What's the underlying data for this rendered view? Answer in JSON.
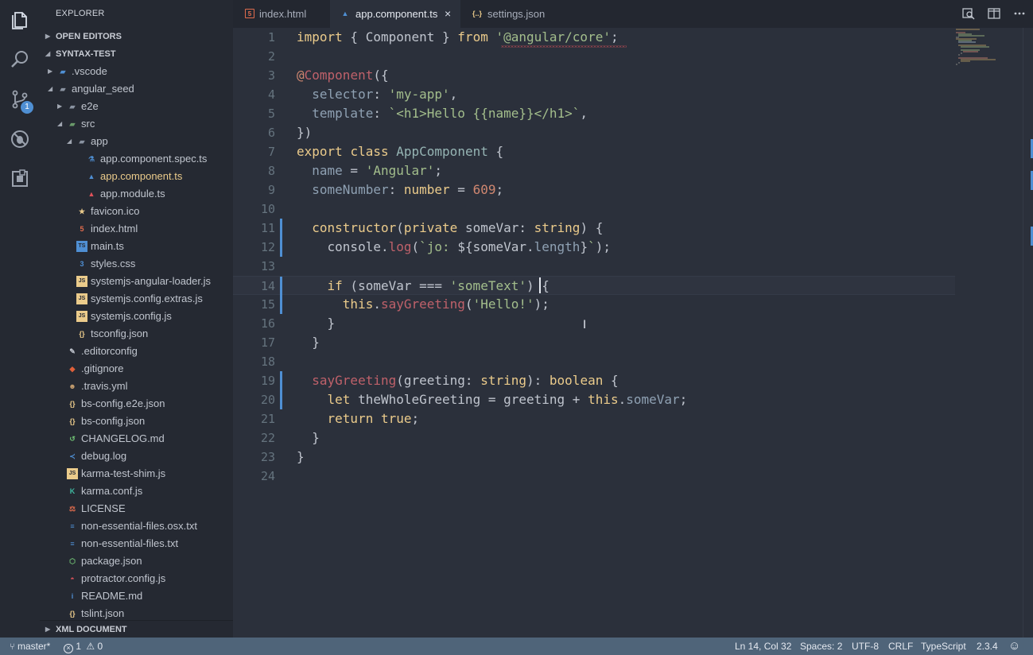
{
  "sidebar": {
    "title": "EXPLORER",
    "open_editors": "OPEN EDITORS",
    "project": "SYNTAX-TEST",
    "xml_section": "XML DOCUMENT",
    "tree": [
      {
        "label": ".vscode",
        "type": "folder-vscode",
        "depth": 1,
        "twisty": "▶"
      },
      {
        "label": "angular_seed",
        "type": "folder",
        "depth": 1,
        "twisty": "◢"
      },
      {
        "label": "e2e",
        "type": "folder",
        "depth": 2,
        "twisty": "▶"
      },
      {
        "label": "src",
        "type": "folder-src",
        "depth": 2,
        "twisty": "◢"
      },
      {
        "label": "app",
        "type": "folder",
        "depth": 3,
        "twisty": "◢"
      },
      {
        "label": "app.component.spec.ts",
        "type": "spec",
        "depth": 4
      },
      {
        "label": "app.component.ts",
        "type": "angular",
        "depth": 4,
        "active": true
      },
      {
        "label": "app.module.ts",
        "type": "angular-red",
        "depth": 4
      },
      {
        "label": "favicon.ico",
        "type": "star",
        "depth": 3
      },
      {
        "label": "index.html",
        "type": "html",
        "depth": 3
      },
      {
        "label": "main.ts",
        "type": "ts",
        "depth": 3
      },
      {
        "label": "styles.css",
        "type": "css",
        "depth": 3
      },
      {
        "label": "systemjs-angular-loader.js",
        "type": "js",
        "depth": 3
      },
      {
        "label": "systemjs.config.extras.js",
        "type": "js",
        "depth": 3
      },
      {
        "label": "systemjs.config.js",
        "type": "js",
        "depth": 3
      },
      {
        "label": "tsconfig.json",
        "type": "json",
        "depth": 3
      },
      {
        "label": ".editorconfig",
        "type": "editorconfig",
        "depth": 2
      },
      {
        "label": ".gitignore",
        "type": "git",
        "depth": 2
      },
      {
        "label": ".travis.yml",
        "type": "travis",
        "depth": 2
      },
      {
        "label": "bs-config.e2e.json",
        "type": "json",
        "depth": 2
      },
      {
        "label": "bs-config.json",
        "type": "json",
        "depth": 2
      },
      {
        "label": "CHANGELOG.md",
        "type": "changelog",
        "depth": 2
      },
      {
        "label": "debug.log",
        "type": "vscode",
        "depth": 2
      },
      {
        "label": "karma-test-shim.js",
        "type": "js",
        "depth": 2
      },
      {
        "label": "karma.conf.js",
        "type": "karma",
        "depth": 2
      },
      {
        "label": "LICENSE",
        "type": "license",
        "depth": 2
      },
      {
        "label": "non-essential-files.osx.txt",
        "type": "txt",
        "depth": 2
      },
      {
        "label": "non-essential-files.txt",
        "type": "txt",
        "depth": 2
      },
      {
        "label": "package.json",
        "type": "npm",
        "depth": 2
      },
      {
        "label": "protractor.config.js",
        "type": "protractor",
        "depth": 2
      },
      {
        "label": "README.md",
        "type": "info",
        "depth": 2
      },
      {
        "label": "tslint.json",
        "type": "json",
        "depth": 2
      }
    ]
  },
  "tabs": [
    {
      "label": "index.html",
      "icon": "html",
      "active": false
    },
    {
      "label": "app.component.ts",
      "icon": "angular",
      "active": true,
      "close": "×"
    },
    {
      "label": "settings.json",
      "icon": "json",
      "active": false
    }
  ],
  "source_control_badge": "1",
  "editor": {
    "current_line": 14,
    "lines": [
      [
        [
          "kw",
          "import"
        ],
        [
          "plain",
          " { Component } "
        ],
        [
          "kw",
          "from"
        ],
        [
          "plain",
          " "
        ],
        [
          "st",
          "'@angular/core'"
        ],
        [
          "plain",
          ";"
        ]
      ],
      [],
      [
        [
          "dec",
          "@"
        ],
        [
          "pr",
          "Component"
        ],
        [
          "plain",
          "({"
        ]
      ],
      [
        [
          "plain",
          "  "
        ],
        [
          "ty",
          "selector"
        ],
        [
          "plain",
          ": "
        ],
        [
          "st",
          "'my-app'"
        ],
        [
          "plain",
          ","
        ]
      ],
      [
        [
          "plain",
          "  "
        ],
        [
          "ty",
          "template"
        ],
        [
          "plain",
          ": "
        ],
        [
          "st",
          "`<h1>Hello {{name}}</h1>`"
        ],
        [
          "plain",
          ","
        ]
      ],
      [
        [
          "plain",
          "})"
        ]
      ],
      [
        [
          "kw",
          "export"
        ],
        [
          "plain",
          " "
        ],
        [
          "kw",
          "class"
        ],
        [
          "plain",
          " "
        ],
        [
          "fn",
          "AppComponent"
        ],
        [
          "plain",
          " {"
        ]
      ],
      [
        [
          "plain",
          "  "
        ],
        [
          "ty",
          "name"
        ],
        [
          "plain",
          " = "
        ],
        [
          "st",
          "'Angular'"
        ],
        [
          "plain",
          ";"
        ]
      ],
      [
        [
          "plain",
          "  "
        ],
        [
          "ty",
          "someNumber"
        ],
        [
          "plain",
          ": "
        ],
        [
          "kw",
          "number"
        ],
        [
          "plain",
          " = "
        ],
        [
          "nm",
          "609"
        ],
        [
          "plain",
          ";"
        ]
      ],
      [],
      [
        [
          "plain",
          "  "
        ],
        [
          "kw",
          "constructor"
        ],
        [
          "plain",
          "("
        ],
        [
          "kw",
          "private"
        ],
        [
          "plain",
          " someVar: "
        ],
        [
          "kw",
          "string"
        ],
        [
          "plain",
          ") {"
        ]
      ],
      [
        [
          "plain",
          "    "
        ],
        [
          "plain",
          "console."
        ],
        [
          "pr",
          "log"
        ],
        [
          "plain",
          "("
        ],
        [
          "st",
          "`jo: "
        ],
        [
          "plain",
          "${someVar."
        ],
        [
          "ty",
          "length"
        ],
        [
          "plain",
          "}"
        ],
        [
          "st",
          "`"
        ],
        [
          "plain",
          ");"
        ]
      ],
      [],
      [
        [
          "plain",
          "    "
        ],
        [
          "kw",
          "if"
        ],
        [
          "plain",
          " (someVar === "
        ],
        [
          "st",
          "'someText'"
        ],
        [
          "plain",
          ") {"
        ]
      ],
      [
        [
          "plain",
          "      "
        ],
        [
          "kw",
          "this"
        ],
        [
          "plain",
          "."
        ],
        [
          "pr",
          "sayGreeting"
        ],
        [
          "plain",
          "("
        ],
        [
          "st",
          "'Hello!'"
        ],
        [
          "plain",
          ");"
        ]
      ],
      [
        [
          "plain",
          "    }"
        ]
      ],
      [
        [
          "plain",
          "  }"
        ]
      ],
      [],
      [
        [
          "plain",
          "  "
        ],
        [
          "pr",
          "sayGreeting"
        ],
        [
          "plain",
          "(greeting: "
        ],
        [
          "kw",
          "string"
        ],
        [
          "plain",
          "): "
        ],
        [
          "kw",
          "boolean"
        ],
        [
          "plain",
          " {"
        ]
      ],
      [
        [
          "plain",
          "    "
        ],
        [
          "kw",
          "let"
        ],
        [
          "plain",
          " theWholeGreeting = greeting + "
        ],
        [
          "kw",
          "this"
        ],
        [
          "plain",
          "."
        ],
        [
          "ty",
          "someVar"
        ],
        [
          "plain",
          ";"
        ]
      ],
      [
        [
          "plain",
          "    "
        ],
        [
          "kw",
          "return"
        ],
        [
          "plain",
          " "
        ],
        [
          "kw",
          "true"
        ],
        [
          "plain",
          ";"
        ]
      ],
      [
        [
          "plain",
          "  }"
        ]
      ],
      [
        [
          "plain",
          "}"
        ]
      ],
      []
    ],
    "modified_lines": [
      11,
      12,
      14,
      15,
      19,
      20
    ]
  },
  "status": {
    "branch": "master*",
    "errors": "1",
    "warnings": "0",
    "position": "Ln 14, Col 32",
    "spaces": "Spaces: 2",
    "encoding": "UTF-8",
    "eol": "CRLF",
    "language": "TypeScript",
    "version": "2.3.4"
  },
  "colors": {
    "accent": "#4f8fd3",
    "status_bar": "#4f6479",
    "editor_bg": "#2b303b"
  }
}
